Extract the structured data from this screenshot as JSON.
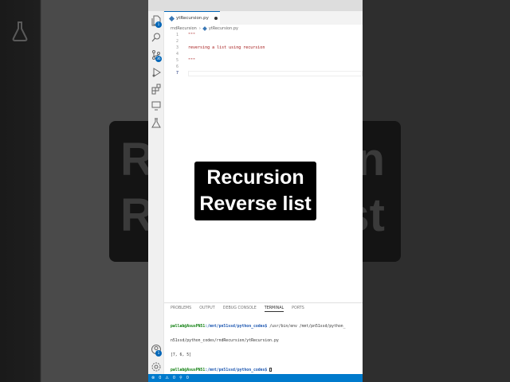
{
  "editor": {
    "tab_name": "ytRecursion.py",
    "breadcrumb": [
      "rndRecursion",
      "ytRecursion.py"
    ],
    "lines": [
      {
        "num": "1",
        "text": "\"\"\""
      },
      {
        "num": "2",
        "text": ""
      },
      {
        "num": "3",
        "text": "reversing a list using recursion"
      },
      {
        "num": "4",
        "text": ""
      },
      {
        "num": "5",
        "text": "\"\"\""
      },
      {
        "num": "6",
        "text": ""
      },
      {
        "num": "7",
        "text": ""
      }
    ]
  },
  "overlay": {
    "line1": "Recursion",
    "line2": "Reverse list"
  },
  "background": {
    "line1": "Re",
    "line2": "Re",
    "line1_end": "n",
    "line2_end": "st"
  },
  "activity_bar": {
    "explorer_badge": "1",
    "scm_badge": "36",
    "accounts_badge": "1"
  },
  "panel": {
    "tabs": [
      "PROBLEMS",
      "OUTPUT",
      "DEBUG CONSOLE",
      "TERMINAL",
      "PORTS"
    ],
    "active_tab": "TERMINAL",
    "terminal": {
      "prompt_user": "pallab@AsusPN51",
      "prompt_path": ":/mnt/pn51ssd/python_codes$",
      "command": " /usr/bin/env /mnt/pn51ssd/python_",
      "command_cont": "n51ssd/python_codes/rndRecursion/ytRecursion.py",
      "output": "[7, 6, 5]"
    }
  },
  "status_bar": {
    "errors": "0",
    "warnings": "0",
    "ports": "0"
  },
  "colors": {
    "accent": "#007acc",
    "string": "#a31515"
  }
}
